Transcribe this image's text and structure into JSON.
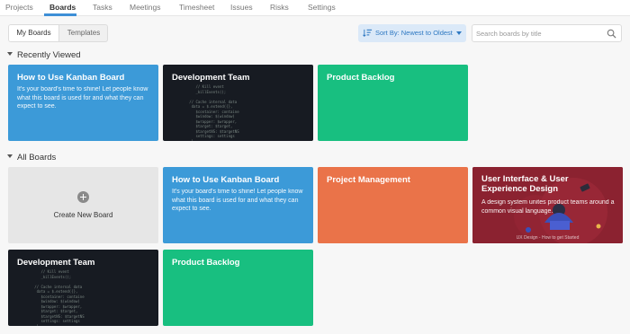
{
  "nav": {
    "tabs": [
      {
        "label": "Projects"
      },
      {
        "label": "Boards"
      },
      {
        "label": "Tasks"
      },
      {
        "label": "Meetings"
      },
      {
        "label": "Timesheet"
      },
      {
        "label": "Issues"
      },
      {
        "label": "Risks"
      },
      {
        "label": "Settings"
      }
    ],
    "active": "Boards"
  },
  "toolbar": {
    "view_tabs": [
      "My Boards",
      "Templates"
    ],
    "sort_label": "Sort By: Newest to Oldest",
    "search_placeholder": "Search boards by title"
  },
  "sections": {
    "recent": "Recently Viewed",
    "all": "All Boards"
  },
  "recent_cards": [
    {
      "title": "How to Use Kanban Board",
      "desc": "It's your board's time to shine! Let people know what this board is used for and what they can expect to see."
    },
    {
      "title": "Development Team"
    },
    {
      "title": "Product Backlog"
    }
  ],
  "all_cards": [
    {
      "create_label": "Create New Board"
    },
    {
      "title": "How to Use Kanban Board",
      "desc": "It's your board's time to shine! Let people know what this board is used for and what they can expect to see."
    },
    {
      "title": "Project Management"
    },
    {
      "title": "User Interface & User Experience Design",
      "desc": "A design system unites product teams around a common visual language.",
      "footer": "UX Design - How to get Started"
    },
    {
      "title": "Development Team"
    },
    {
      "title": "Product Backlog"
    }
  ],
  "colors": {
    "accent": "#3d8fd6",
    "blue_card": "#3c9ad8",
    "green_card": "#18bf80",
    "orange_card": "#ea7349",
    "dark_card": "#171b22"
  }
}
